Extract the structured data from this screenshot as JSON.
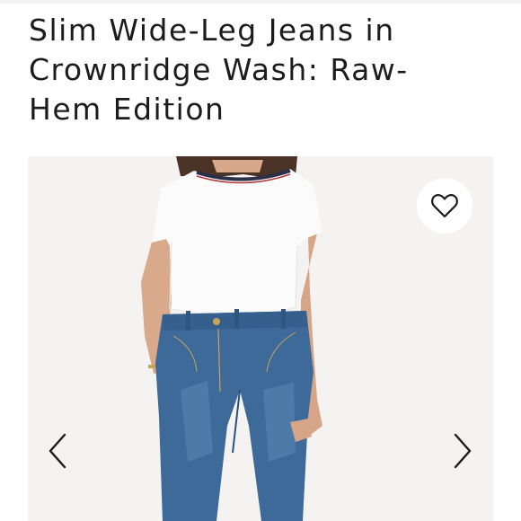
{
  "product": {
    "title_lines": [
      "Slim Wide-Leg Jeans in",
      "Crownridge Wash: Raw-",
      "Hem Edition"
    ]
  },
  "gallery": {
    "image": "model-wearing-white-tee-and-blue-wide-leg-jeans",
    "favorite_icon": "heart-outline-icon",
    "prev_icon": "chevron-left-icon",
    "next_icon": "chevron-right-icon"
  },
  "colors": {
    "text": "#1c1c1c",
    "image_background": "#f4f3f1",
    "denim": "#3e6a9a",
    "tee": "#fbfbfb",
    "fav_button_bg": "#ffffff"
  }
}
